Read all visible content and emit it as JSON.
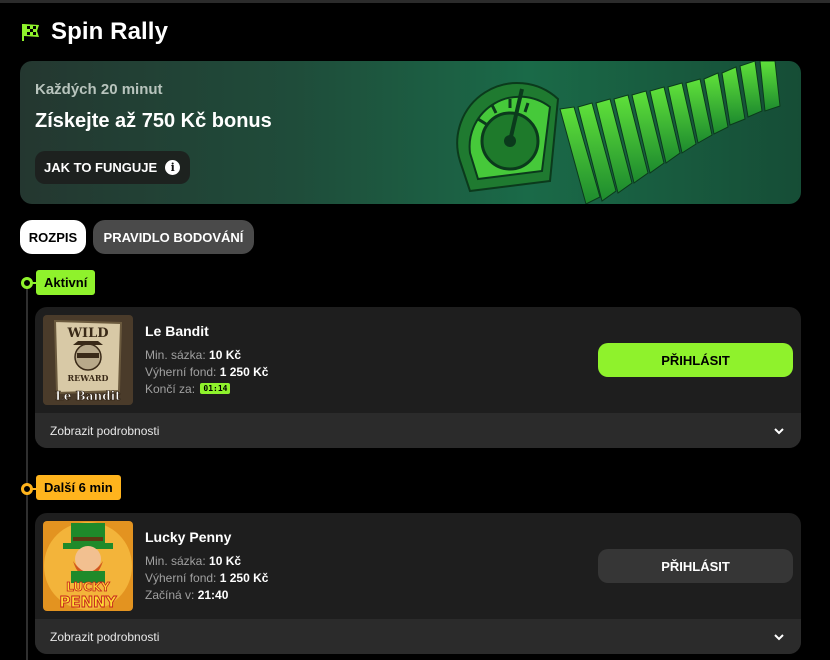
{
  "page": {
    "title": "Spin Rally",
    "title_icon": "checkered-flag-icon"
  },
  "banner": {
    "subtitle": "Každých 20 minut",
    "headline": "Získejte až 750 Kč bonus",
    "how_button": "JAK TO FUNGUJE",
    "info_icon": "info-icon",
    "art_icon": "speedometer-rally-art"
  },
  "tabs": [
    {
      "label": "ROZPIS",
      "active": true
    },
    {
      "label": "PRAVIDLO BODOVÁNÍ",
      "active": false
    }
  ],
  "sections": [
    {
      "badge": "Aktivní",
      "badge_color": "#8ff22c",
      "game": {
        "name": "Le Bandit",
        "bet_label": "Min. sázka:",
        "bet_value": "10 Kč",
        "pool_label": "Výherní fond:",
        "pool_value": "1 250 Kč",
        "time_label": "Končí za:",
        "time_value": "01:14",
        "thumb_text_top": "WILD",
        "thumb_text_mid": "REWARD",
        "thumb_text_bottom": "Le Bandit",
        "join_label": "PŘIHLÁSIT",
        "details_label": "Zobrazit podrobnosti"
      }
    },
    {
      "badge": "Další 6 min",
      "badge_color": "#ffb41d",
      "game": {
        "name": "Lucky Penny",
        "bet_label": "Min. sázka:",
        "bet_value": "10 Kč",
        "pool_label": "Výherní fond:",
        "pool_value": "1 250 Kč",
        "time_label": "Začíná v:",
        "time_value": "21:40",
        "thumb_text_top": "LUCKY",
        "thumb_text_bottom": "PENNY",
        "join_label": "PŘIHLÁSIT",
        "details_label": "Zobrazit podrobnosti"
      }
    }
  ]
}
